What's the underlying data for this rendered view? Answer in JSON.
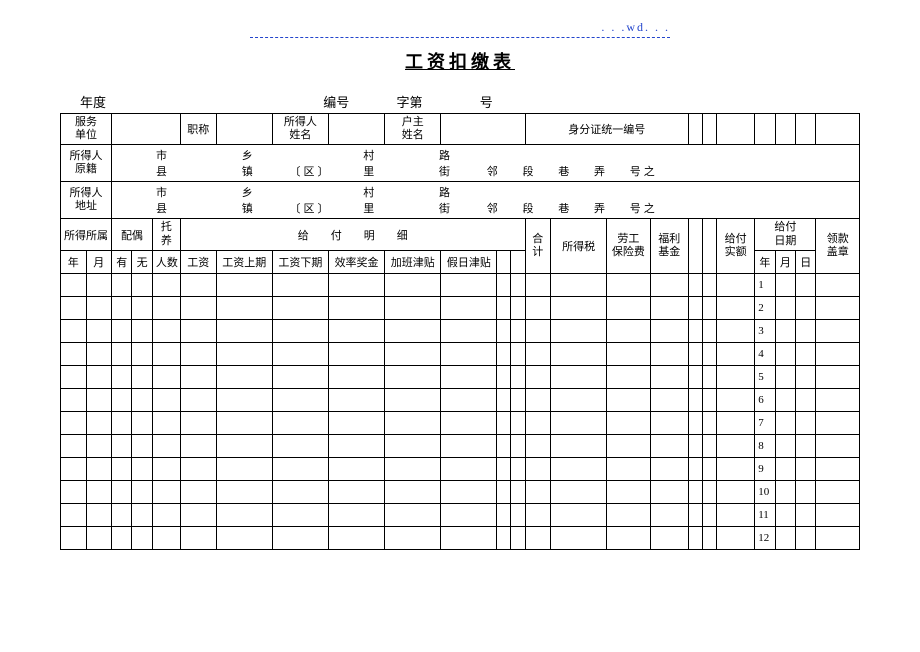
{
  "header_link": ". . .wd. . .",
  "title": "工资扣缴表",
  "meta": {
    "year_label": "年度",
    "serial_label": "编号",
    "zi_label": "字第",
    "hao_label": "号"
  },
  "row1": {
    "service_unit": "服务\n单位",
    "job_title": "职称",
    "income_name": "所得人\n姓名",
    "household_name": "户主\n姓名",
    "id_label": "身分证统一编号"
  },
  "addr_origin_label": "所得人\n原籍",
  "addr_addr_label": "所得人\n地址",
  "addr_parts": {
    "city": "市",
    "county": "县",
    "township": "乡",
    "town": "镇",
    "district": "〔区〕",
    "village": "村",
    "li": "里",
    "road": "路",
    "street": "街",
    "lin": "邻",
    "duan": "段",
    "xiang": "巷",
    "nong": "弄",
    "hao_zhi": "号之"
  },
  "headers": {
    "income_family": "所得所属",
    "spouse": "配偶",
    "support": "托养",
    "payment_detail": "给　　付　　明　　细",
    "income_tax": "所得税",
    "labor_ins": "劳工\n保险费",
    "welfare": "福利\n基金",
    "net_pay": "给付\n实额",
    "pay_date": "给付\n日期",
    "receipt": "领款\n盖章",
    "year": "年",
    "month": "月",
    "day": "日",
    "has": "有",
    "none": "无",
    "people": "人数",
    "salary": "工资",
    "salary_prev": "工资上期",
    "salary_next": "工资下期",
    "bonus": "效率奖金",
    "overtime": "加班津贴",
    "holiday": "假日津贴",
    "total": "合\n计"
  },
  "row_numbers": [
    "1",
    "2",
    "3",
    "4",
    "5",
    "6",
    "7",
    "8",
    "9",
    "10",
    "11",
    "12"
  ]
}
